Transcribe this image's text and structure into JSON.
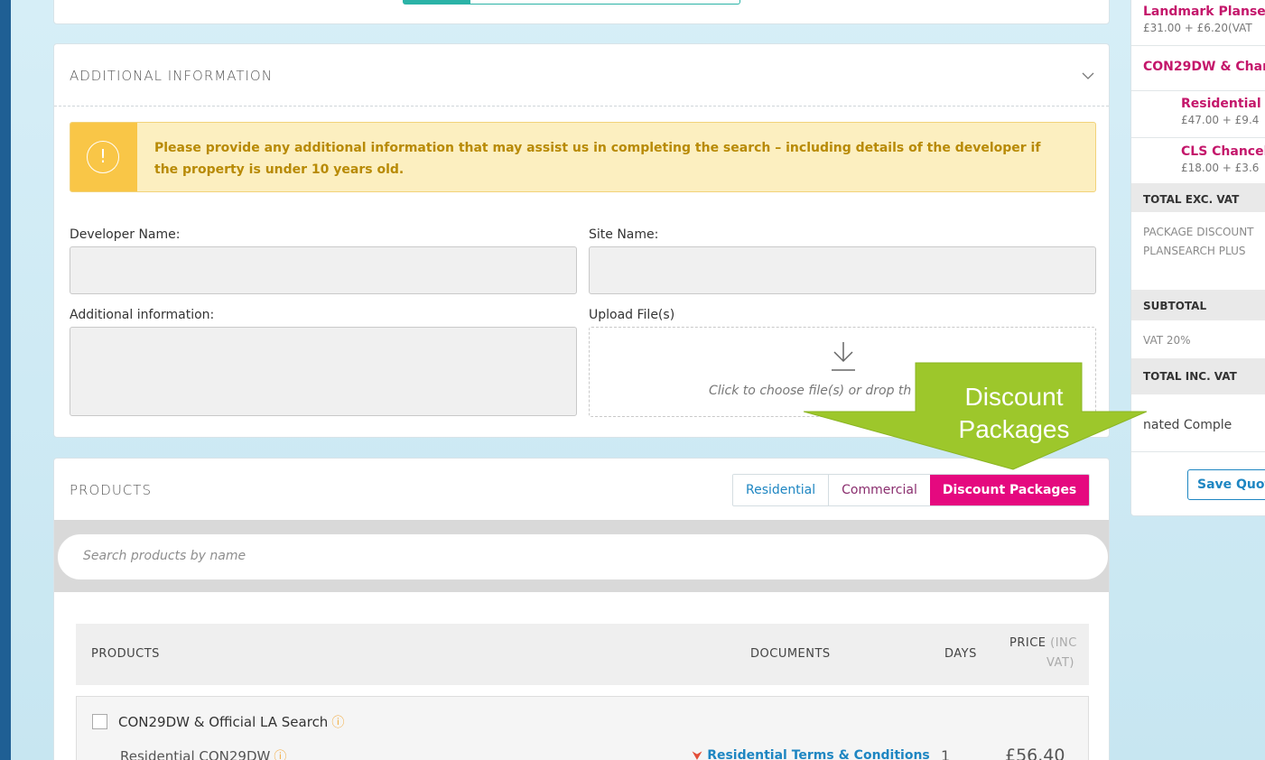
{
  "additional_info": {
    "title": "ADDITIONAL INFORMATION",
    "alert_text": "Please provide any additional information that may assist us in completing the search – including details of the developer if the property is under 10 years old.",
    "developer_label": "Developer Name:",
    "site_label": "Site Name:",
    "additional_label": "Additional information:",
    "upload_label": "Upload File(s)",
    "upload_hint": "Click to choose file(s) or drop th"
  },
  "products": {
    "title": "PRODUCTS",
    "tabs": [
      "Residential",
      "Commercial",
      "Discount Packages"
    ],
    "search_placeholder": "Search products by name",
    "columns": {
      "products": "PRODUCTS",
      "documents": "DOCUMENTS",
      "days": "DAYS",
      "price": "PRICE",
      "price_sub1": "(INC",
      "price_sub2": "VAT)"
    },
    "row": {
      "title": "CON29DW & Official LA Search",
      "sub": "Residential CON29DW",
      "document": "Residential Terms & Conditions",
      "days": "1",
      "price": "£56.40"
    }
  },
  "side": {
    "item1_name": "Landmark Planse",
    "item1_price": "£31.00 + £6.20(VAT",
    "item2_name": "CON29DW & Chan",
    "item3_name": "Residential C",
    "item3_price": "£47.00 + £9.4",
    "item4_name": "CLS Chancel",
    "item4_price": "£18.00 + £3.6",
    "total_exc": "TOTAL EXC. VAT",
    "package_discount": "PACKAGE DISCOUNT",
    "plansearch": "PLANSEARCH PLUS",
    "subtotal": "SUBTOTAL",
    "vat": "VAT 20%",
    "total_inc": "TOTAL INC. VAT",
    "estimated": "nated Comple",
    "save_quote": "Save Quote"
  },
  "callout": {
    "line1": "Discount",
    "line2": "Packages",
    "color": "#9dc72b"
  }
}
